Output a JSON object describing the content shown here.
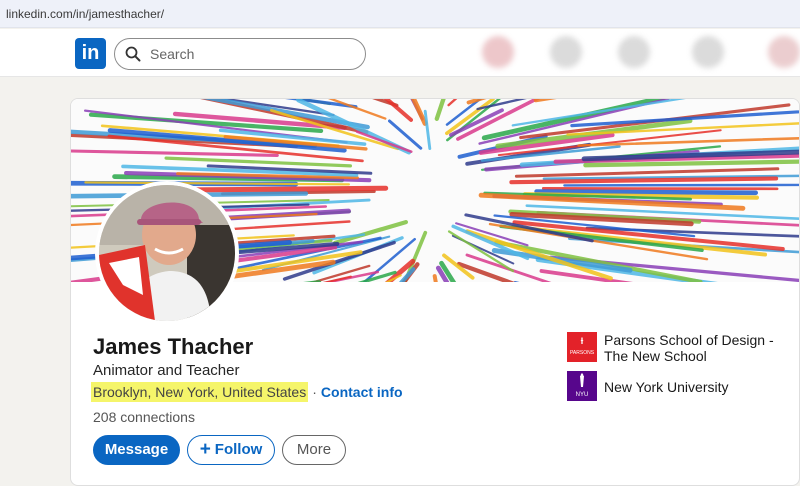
{
  "browser": {
    "url": "linkedin.com/in/jamesthacher/"
  },
  "nav": {
    "logo_text": "in",
    "search_placeholder": "Search"
  },
  "profile": {
    "name": "James Thacher",
    "headline": "Animator and Teacher",
    "location": "Brooklyn, New York, United States",
    "separator": "·",
    "contact_label": "Contact info",
    "connections": "208 connections",
    "buttons": {
      "message": "Message",
      "follow": "Follow",
      "more": "More"
    }
  },
  "education": [
    {
      "name": "Parsons School of Design - The New School",
      "logo_text": "PARSONS",
      "logo_color": "#e32229"
    },
    {
      "name": "New York University",
      "logo_text": "NYU",
      "logo_color": "#57068c"
    }
  ],
  "colors": {
    "brand": "#0a66c2",
    "highlight": "#f5f56a"
  },
  "icons": [
    "linkedin-logo-icon",
    "search-icon",
    "plus-icon",
    "parsons-logo-icon",
    "nyu-torch-icon"
  ]
}
